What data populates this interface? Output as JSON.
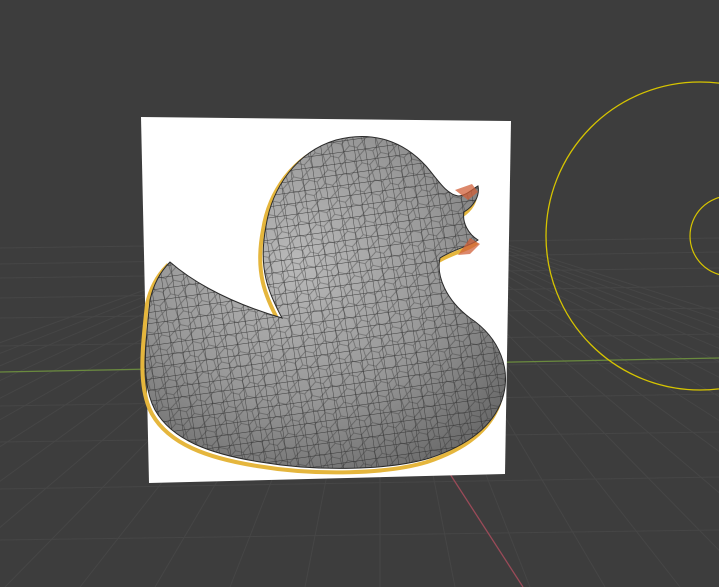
{
  "viewport": {
    "mode": "3d-viewport",
    "background_color": "#3d3d3d",
    "grid_color": "#464646",
    "x_axis_color": "#6a8a3e",
    "y_axis_color": "#9a4a58",
    "light_gizmo_color": "#d6c400"
  },
  "scene": {
    "reference_plane_color": "#ffffff",
    "mesh_object": "duck-mesh",
    "mesh_fill_color": "#8e8e8e",
    "mesh_wire_color": "#2a2a2a",
    "silhouette_outline_color": "#e5b63d",
    "beak_highlight_color": "#d0603a"
  }
}
